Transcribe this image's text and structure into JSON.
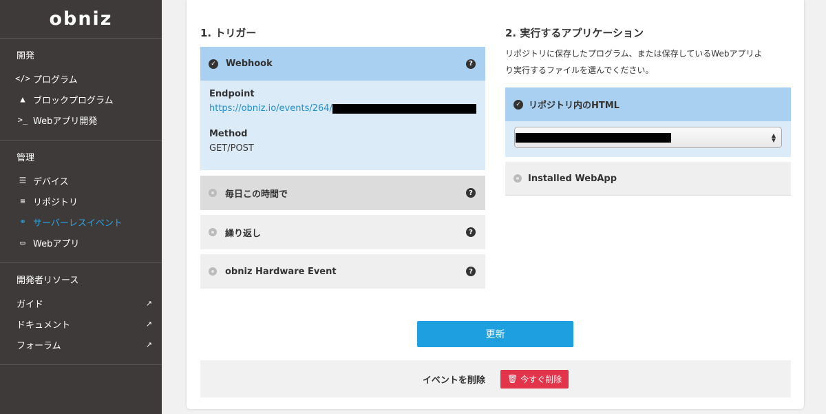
{
  "sidebar": {
    "logo": "obniz",
    "sections": [
      {
        "title": "開発",
        "items": [
          {
            "icon": "</>",
            "label": "プログラム"
          },
          {
            "icon": "▲",
            "label": "ブロックプログラム"
          },
          {
            "icon": ">_",
            "label": "Webアプリ開発"
          }
        ]
      },
      {
        "title": "管理",
        "items": [
          {
            "icon": "☰",
            "label": "デバイス"
          },
          {
            "icon": "≡",
            "label": "リポジトリ"
          },
          {
            "icon": "⚭",
            "label": "サーバーレスイベント"
          },
          {
            "icon": "▭",
            "label": "Webアプリ"
          }
        ]
      },
      {
        "title": "開発者リソース",
        "items": [
          {
            "label": "ガイド",
            "ext": "↗"
          },
          {
            "label": "ドキュメント",
            "ext": "↗"
          },
          {
            "label": "フォーラム",
            "ext": "↗"
          }
        ]
      }
    ]
  },
  "trigger": {
    "title": "1. トリガー",
    "webhook_label": "Webhook",
    "endpoint_label": "Endpoint",
    "endpoint_url": "https://obniz.io/events/264/",
    "method_label": "Method",
    "method_value": "GET/POST",
    "options": [
      "毎日この時間で",
      "繰り返し",
      "obniz Hardware Event"
    ],
    "help_glyph": "?"
  },
  "app": {
    "title": "2. 実行するアプリケーション",
    "desc_line1": "リポジトリに保存したプログラム、または保存しているWebアプリよ",
    "desc_line2": "り実行するファイルを選んでください。",
    "option_html": "リポジトリ内のHTML",
    "option_webapp": "Installed WebApp"
  },
  "actions": {
    "update_label": "更新",
    "delete_event_label": "イベントを削除",
    "delete_now_label": "今すぐ削除"
  },
  "colors": {
    "accent": "#1ea0e0",
    "active_nav": "#2ca6e0",
    "danger": "#e2344a",
    "selected_header": "#a9d0f0",
    "selected_body": "#dcebf8"
  }
}
